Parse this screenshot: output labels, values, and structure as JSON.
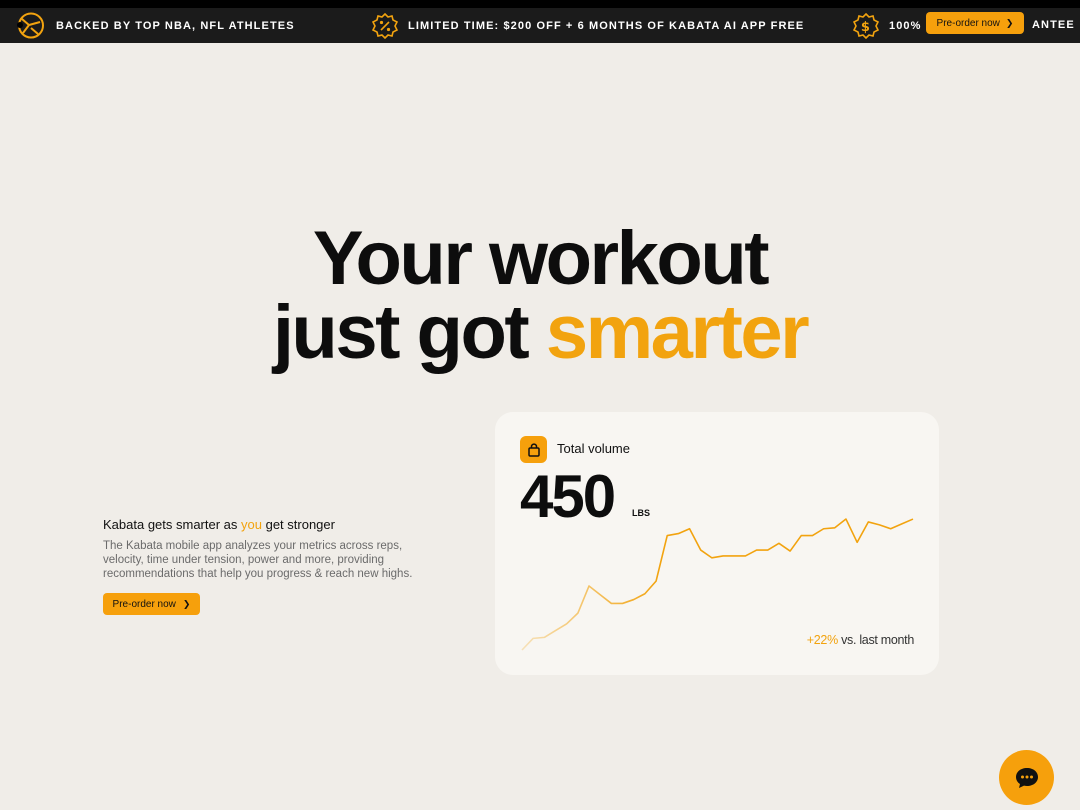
{
  "banner": {
    "item1": "Backed by top NBA, NFL athletes",
    "item2_prefix": "Limited time: ",
    "item2_amount": "$200 off",
    "item2_mid": " + 6 months of Kabata AI app ",
    "item2_free": "free",
    "item3": "100% M",
    "item3_tail": "ANTEE",
    "preorder_label": "Pre-order now"
  },
  "hero": {
    "line1": "Your workout",
    "line2_prefix": "just got ",
    "line2_accent": "smarter"
  },
  "feature": {
    "heading_prefix": "Kabata gets smarter as ",
    "heading_accent": "you",
    "heading_suffix": " get stronger",
    "body": "The Kabata mobile app analyzes your metrics across reps, velocity, time under tension, power and more, providing recommendations that help you progress & reach new highs.",
    "cta_label": "Pre-order now"
  },
  "card": {
    "title": "Total volume",
    "value": "450",
    "unit": "LBS",
    "delta_pct": "+22%",
    "delta_text": " vs. last month"
  },
  "colors": {
    "accent": "#f2a30f",
    "banner_bg": "#1b1b1b",
    "page_bg": "#f0ede8"
  },
  "icons": {
    "logo": "kabata-logo-icon",
    "percent": "percent-badge-icon",
    "dollar": "dollar-badge-icon",
    "bag": "shopping-bag-icon",
    "chat": "chat-icon"
  },
  "chart_data": {
    "type": "line",
    "series": [
      {
        "values": [
          0,
          12,
          13,
          20,
          27,
          38,
          66,
          57,
          48,
          48,
          52,
          58,
          71,
          118,
          120,
          125,
          103,
          95,
          97,
          97,
          97,
          103,
          103,
          110,
          102,
          118,
          118,
          125,
          126,
          135,
          111,
          132,
          129,
          125,
          130,
          135
        ]
      }
    ],
    "xlabel": "",
    "ylabel": "",
    "grid": false,
    "legend": "none"
  }
}
